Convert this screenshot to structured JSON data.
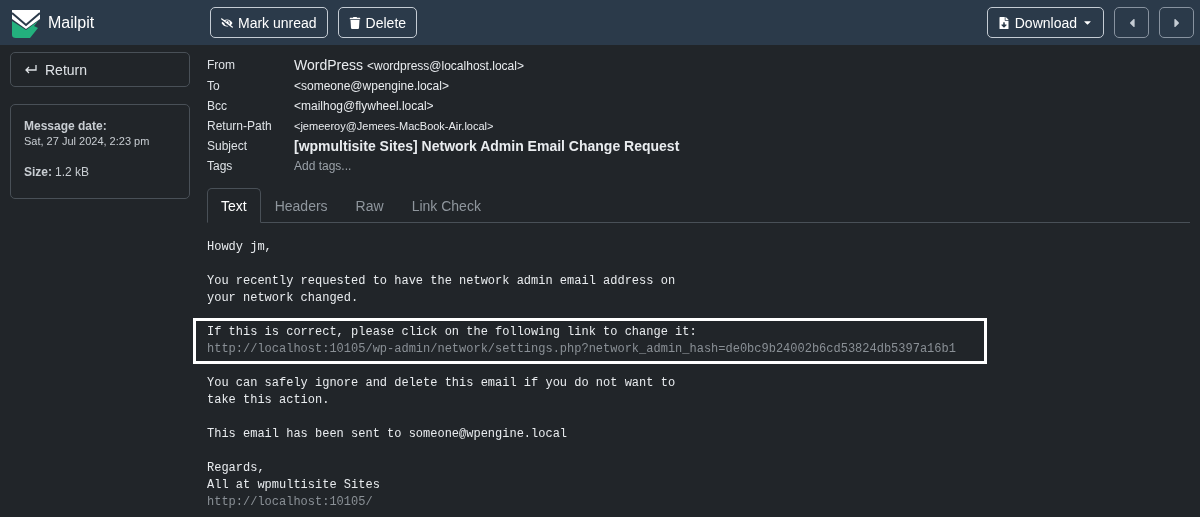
{
  "app": {
    "name": "Mailpit"
  },
  "toolbar": {
    "buttons": [
      {
        "label": "Mark unread",
        "kind": "mark-unread"
      },
      {
        "label": "Delete",
        "kind": "delete"
      }
    ],
    "download": {
      "label": "Download"
    },
    "nav": [
      {
        "kind": "previous"
      },
      {
        "kind": "next"
      }
    ]
  },
  "sidebar": {
    "return_button": "Return",
    "info": [
      {
        "label": "Message date:",
        "value": "Sat, 27 Jul 2024, 2:23 pm",
        "kind": "block"
      },
      {
        "label": "Size:",
        "value": "1.2 kB",
        "kind": "inline"
      }
    ]
  },
  "headers": [
    {
      "label": "From",
      "name": "WordPress",
      "value": "<wordpress@localhost.local>",
      "kind": "sender"
    },
    {
      "label": "To",
      "value": "<someone@wpengine.local>",
      "kind": "plain"
    },
    {
      "label": "Bcc",
      "value": "<mailhog@flywheel.local>",
      "kind": "plain"
    },
    {
      "label": "Return-Path",
      "value": "<jemeeroy@Jemees-MacBook-Air.local>",
      "kind": "small"
    },
    {
      "label": "Subject",
      "value": "[wpmultisite Sites] Network Admin Email Change Request",
      "kind": "subject"
    },
    {
      "label": "Tags",
      "placeholder": "Add tags...",
      "kind": "tags"
    }
  ],
  "tabs": [
    {
      "label": "Text",
      "selected": true
    },
    {
      "label": "Headers",
      "selected": false
    },
    {
      "label": "Raw",
      "selected": false
    },
    {
      "label": "Link Check",
      "selected": false
    }
  ],
  "body": [
    {
      "text": "Howdy jm,",
      "highlighted": false
    },
    {
      "text": "You recently requested to have the network admin email address on\nyour network changed.",
      "highlighted": false
    },
    {
      "text": "If this is correct, please click on the following link to change it:",
      "link": "http://localhost:10105/wp-admin/network/settings.php?network_admin_hash=de0bc9b24002b6cd53824db5397a16b1",
      "highlighted": true
    },
    {
      "text": "You can safely ignore and delete this email if you do not want to\ntake this action.",
      "highlighted": false
    },
    {
      "text": "This email has been sent to someone@wpengine.local",
      "highlighted": false
    },
    {
      "text": "Regards,\nAll at wpmultisite Sites",
      "link": "http://localhost:10105/",
      "highlighted": false
    }
  ]
}
